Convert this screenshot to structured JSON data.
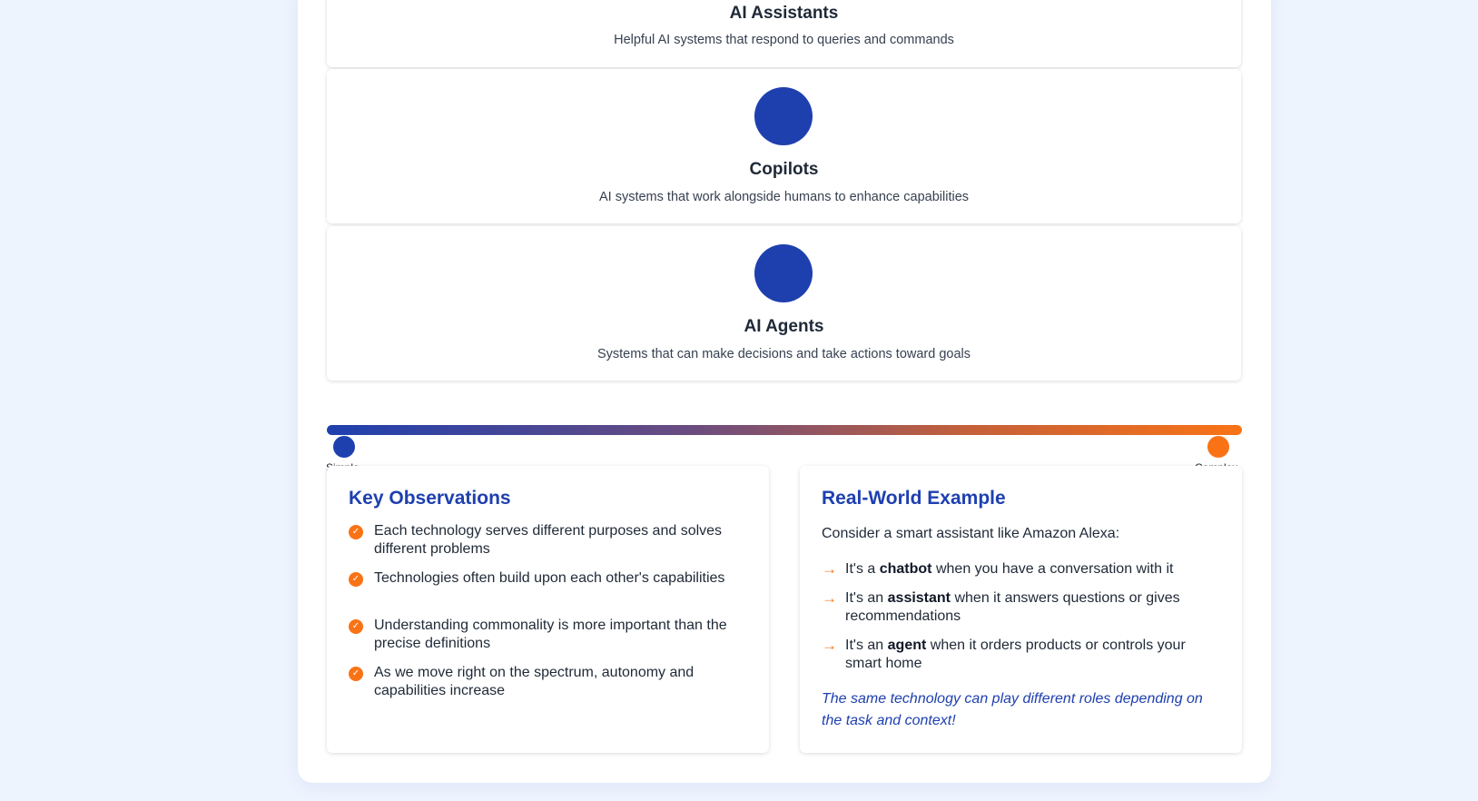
{
  "tiers": [
    {
      "title": "AI Assistants",
      "description": "Helpful AI systems that respond to queries and commands"
    },
    {
      "title": "Copilots",
      "description": "AI systems that work alongside humans to enhance capabilities"
    },
    {
      "title": "AI Agents",
      "description": "Systems that can make decisions and take actions toward goals"
    }
  ],
  "spectrum": {
    "left_label": "Simple",
    "right_label": "Complex",
    "colors": {
      "start": "#1e40af",
      "end": "#f97316"
    }
  },
  "observations": {
    "heading": "Key Observations",
    "icon": "check-circle-icon",
    "items": [
      "Each technology serves different purposes and solves different problems",
      "Technologies often build upon each other's capabilities",
      "Understanding commonality is more important than the precise definitions",
      "As we move right on the spectrum, autonomy and capabilities increase"
    ]
  },
  "example": {
    "heading": "Real-World Example",
    "intro": "Consider a smart assistant like Amazon Alexa:",
    "icon": "arrow-right-icon",
    "items": [
      {
        "prefix": "It's a ",
        "keyword": "chatbot",
        "suffix": " when you have a conversation with it"
      },
      {
        "prefix": "It's an ",
        "keyword": "assistant",
        "suffix": " when it answers questions or gives recommendations"
      },
      {
        "prefix": "It's an ",
        "keyword": "agent",
        "suffix": " when it orders products or controls your smart home"
      }
    ],
    "note": "The same technology can play different roles depending on the task and context!"
  },
  "colors": {
    "accent": "#1e40af",
    "highlight": "#f97316",
    "background": "#eef4fe"
  }
}
